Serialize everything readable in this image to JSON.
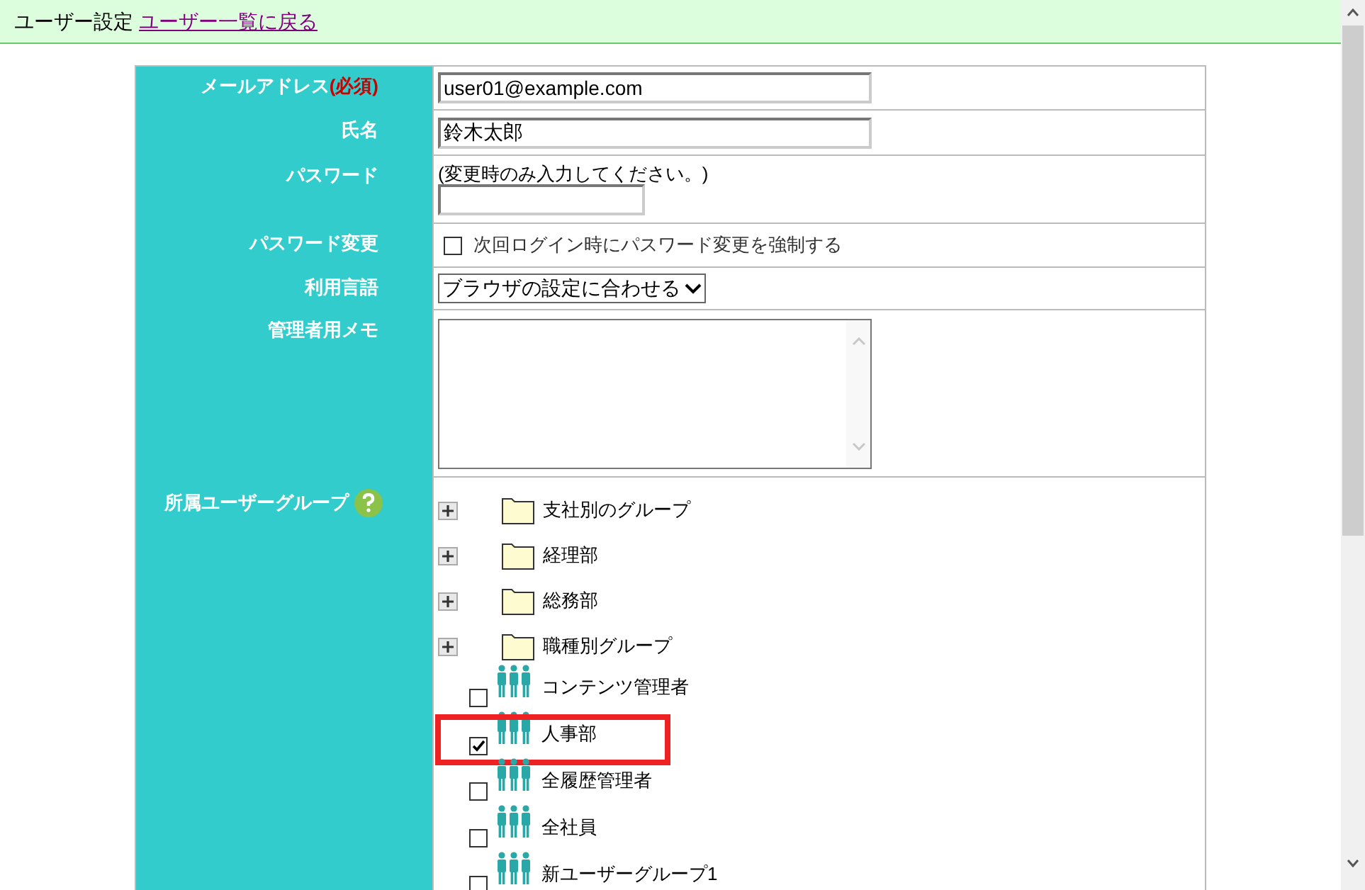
{
  "header": {
    "title": "ユーザー設定",
    "back_link": "ユーザー一覧に戻る"
  },
  "form": {
    "email": {
      "label": "メールアドレス",
      "required": "(必須)",
      "value": "user01@example.com"
    },
    "name": {
      "label": "氏名",
      "value": "鈴木太郎"
    },
    "password": {
      "label": "パスワード",
      "note": "(変更時のみ入力してください。)"
    },
    "password_change": {
      "label": "パスワード変更",
      "option": "次回ログイン時にパスワード変更を強制する",
      "checked": false
    },
    "language": {
      "label": "利用言語",
      "value": "ブラウザの設定に合わせる"
    },
    "memo": {
      "label": "管理者用メモ"
    },
    "groups": {
      "label": "所属ユーザーグループ",
      "items": [
        {
          "kind": "folder",
          "label": "支社別のグループ"
        },
        {
          "kind": "folder",
          "label": "経理部"
        },
        {
          "kind": "folder",
          "label": "総務部"
        },
        {
          "kind": "folder",
          "label": "職種別グループ"
        },
        {
          "kind": "group",
          "label": "コンテンツ管理者",
          "checked": false,
          "highlighted": false
        },
        {
          "kind": "group",
          "label": "人事部",
          "checked": true,
          "highlighted": true
        },
        {
          "kind": "group",
          "label": "全履歴管理者",
          "checked": false,
          "highlighted": false
        },
        {
          "kind": "group",
          "label": "全社員",
          "checked": false,
          "highlighted": false
        },
        {
          "kind": "group",
          "label": "新ユーザーグループ1",
          "checked": false,
          "highlighted": false
        }
      ]
    }
  }
}
